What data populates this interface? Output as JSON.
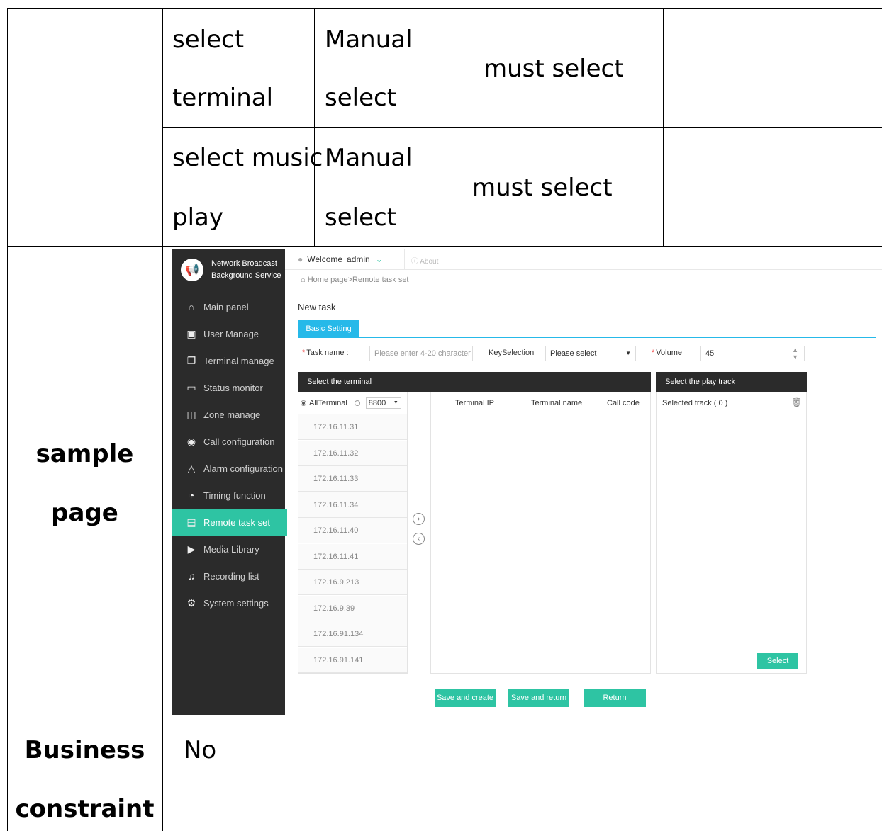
{
  "doc_table": {
    "row_terminal": {
      "name": [
        "select",
        "terminal"
      ],
      "type": [
        "Manual",
        "select"
      ],
      "rule": "must select"
    },
    "row_music": {
      "name": [
        "select music",
        "play"
      ],
      "type": [
        "Manual",
        "select"
      ],
      "rule": "must select"
    },
    "row_sample": {
      "label": [
        "sample",
        "page"
      ]
    },
    "row_constraint": {
      "label": [
        "Business",
        "constraint"
      ],
      "value": "No"
    }
  },
  "app": {
    "brand": [
      "Network Broadcast",
      "Background Service"
    ],
    "nav": [
      {
        "label": "Main panel",
        "icon": "home-icon",
        "glyph": "⌂"
      },
      {
        "label": "User Manage",
        "icon": "user-card-icon",
        "glyph": "▣"
      },
      {
        "label": "Terminal manage",
        "icon": "terminal-icon",
        "glyph": "❐"
      },
      {
        "label": "Status monitor",
        "icon": "monitor-icon",
        "glyph": "▭"
      },
      {
        "label": "Zone manage",
        "icon": "zone-icon",
        "glyph": "◫"
      },
      {
        "label": "Call configuration",
        "icon": "broadcast-icon",
        "glyph": "◉"
      },
      {
        "label": "Alarm configuration",
        "icon": "bell-icon",
        "glyph": "△"
      },
      {
        "label": "Timing function",
        "icon": "timer-icon",
        "glyph": "◔"
      },
      {
        "label": "Remote task set",
        "icon": "remote-task-icon",
        "glyph": "▤"
      },
      {
        "label": "Media Library",
        "icon": "media-icon",
        "glyph": "▶"
      },
      {
        "label": "Recording list",
        "icon": "microphone-icon",
        "glyph": "♫"
      },
      {
        "label": "System settings",
        "icon": "gear-icon",
        "glyph": "⚙"
      }
    ],
    "active_nav": "Remote task set",
    "welcome": "Welcome",
    "user": "admin",
    "about": "About",
    "breadcrumb": "Home page>Remote task set",
    "page_title": "New task",
    "tab": "Basic Setting",
    "form": {
      "task_name_label": "Task name :",
      "task_name_placeholder": "Please enter 4-20 character",
      "key_label": "KeySelection",
      "key_value": "Please select",
      "volume_label": "Volume",
      "volume_value": "45"
    },
    "terminal_panel": {
      "title": "Select the terminal",
      "all_label": "AllTerminal",
      "port": "8800",
      "ips": [
        "172.16.11.31",
        "172.16.11.32",
        "172.16.11.33",
        "172.16.11.34",
        "172.16.11.40",
        "172.16.11.41",
        "172.16.9.213",
        "172.16.9.39",
        "172.16.91.134",
        "172.16.91.141"
      ],
      "columns": [
        "Terminal IP",
        "Terminal name",
        "Call code"
      ]
    },
    "track_panel": {
      "title": "Select the play track",
      "selected": "Selected track ( 0 )",
      "select_button": "Select"
    },
    "buttons": {
      "save_create": "Save and create",
      "save_return": "Save and return",
      "return": "Return"
    },
    "colors": {
      "accent": "#2ec4a3",
      "tab_blue": "#26b9e9",
      "sidebar": "#2b2b2b"
    }
  }
}
